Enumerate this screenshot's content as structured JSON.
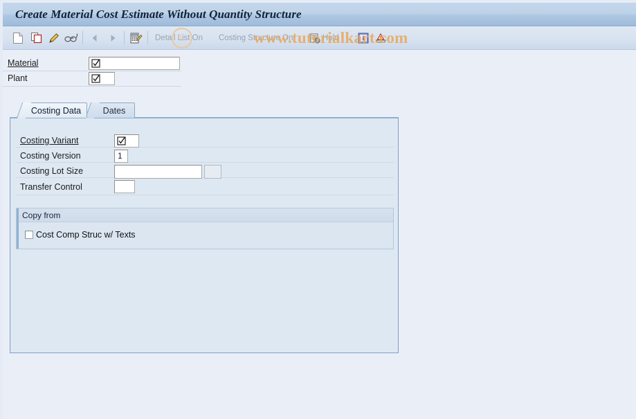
{
  "window": {
    "title": "Create Material Cost Estimate Without Quantity Structure"
  },
  "watermark": {
    "text": "www.tutorialkart.com",
    "copyright_glyph": "©"
  },
  "toolbar": {
    "buttons": [
      {
        "name": "new-document",
        "icon": "document-icon",
        "label": ""
      },
      {
        "name": "copy",
        "icon": "copy-icon",
        "label": ""
      },
      {
        "name": "change",
        "icon": "pencil-icon",
        "label": ""
      },
      {
        "name": "display",
        "icon": "glasses-icon",
        "label": ""
      },
      {
        "name": "back",
        "icon": "triangle-left-icon",
        "label": ""
      },
      {
        "name": "forward",
        "icon": "triangle-right-icon",
        "label": ""
      },
      {
        "name": "costing-edit",
        "icon": "calculator-pencil-icon",
        "label": ""
      }
    ],
    "detail_list_label": "Detail List On",
    "costing_structure_label": "Costing Structure On",
    "hold_label": "Hold",
    "hold_icon": "hold-icon",
    "info_icon": "info-icon",
    "message_icon": "message-warning-icon"
  },
  "header_form": {
    "fields": [
      {
        "label": "Material",
        "required": true,
        "value": "",
        "glyph": "checked-box-glyph"
      },
      {
        "label": "Plant",
        "required": false,
        "value": "",
        "glyph": "checked-box-glyph"
      }
    ]
  },
  "tabs": [
    {
      "label": "Costing Data",
      "active": true
    },
    {
      "label": "Dates",
      "active": false
    }
  ],
  "costing_data": {
    "fields": [
      {
        "label": "Costing Variant",
        "required": true,
        "value": "",
        "glyph": "checked-box-glyph"
      },
      {
        "label": "Costing Version",
        "required": false,
        "value": "1",
        "glyph": ""
      },
      {
        "label": "Costing Lot Size",
        "required": false,
        "value": "",
        "glyph": "",
        "has_unit_field": true,
        "unit_value": ""
      },
      {
        "label": "Transfer Control",
        "required": false,
        "value": "",
        "glyph": ""
      }
    ],
    "copy_from": {
      "title": "Copy from",
      "checkbox_label": "Cost Comp Struc w/ Texts",
      "checked": false
    }
  },
  "colors": {
    "background": "#eaeff7",
    "titlebar_top": "#c3d6ea",
    "titlebar_bottom": "#9fbcdb",
    "panel_bg": "#dee8f2",
    "panel_border": "#7e9fc4",
    "watermark": "#e8a85a",
    "accent_blue": "#8fb2d4"
  }
}
